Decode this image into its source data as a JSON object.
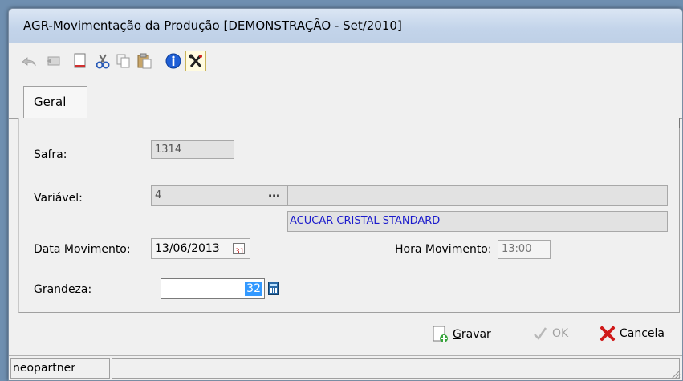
{
  "window": {
    "title": "AGR-Movimentação da Produção [DEMONSTRAÇÃO - Set/2010]"
  },
  "toolbar": {
    "icons": [
      "undo-icon",
      "redo-icon",
      "new-document-icon",
      "cut-icon",
      "copy-icon",
      "paste-icon",
      "info-icon",
      "tools-icon"
    ]
  },
  "tabs": [
    {
      "label": "Geral",
      "active": true
    }
  ],
  "form": {
    "safra": {
      "label": "Safra:",
      "value": "1314"
    },
    "variavel": {
      "label": "Variável:",
      "value": "4",
      "lookup_button": "...",
      "description": "ACUCAR CRISTAL STANDARD"
    },
    "data_movimento": {
      "label": "Data Movimento:",
      "value": "13/06/2013"
    },
    "hora_movimento": {
      "label": "Hora Movimento:",
      "value": "13:00"
    },
    "grandeza": {
      "label": "Grandeza:",
      "value": "32"
    }
  },
  "actions": {
    "gravar": {
      "label": "Gravar",
      "mnemonic": "G",
      "rest": "ravar"
    },
    "ok": {
      "label": "OK",
      "mnemonic": "O",
      "rest": "K"
    },
    "cancela": {
      "label": "Cancela",
      "mnemonic": "C",
      "rest": "ancela"
    }
  },
  "statusbar": {
    "user": "neopartner"
  },
  "colors": {
    "link_blue": "#1a1acc",
    "selection_blue": "#3399ff",
    "cancel_red": "#d01a1a"
  }
}
